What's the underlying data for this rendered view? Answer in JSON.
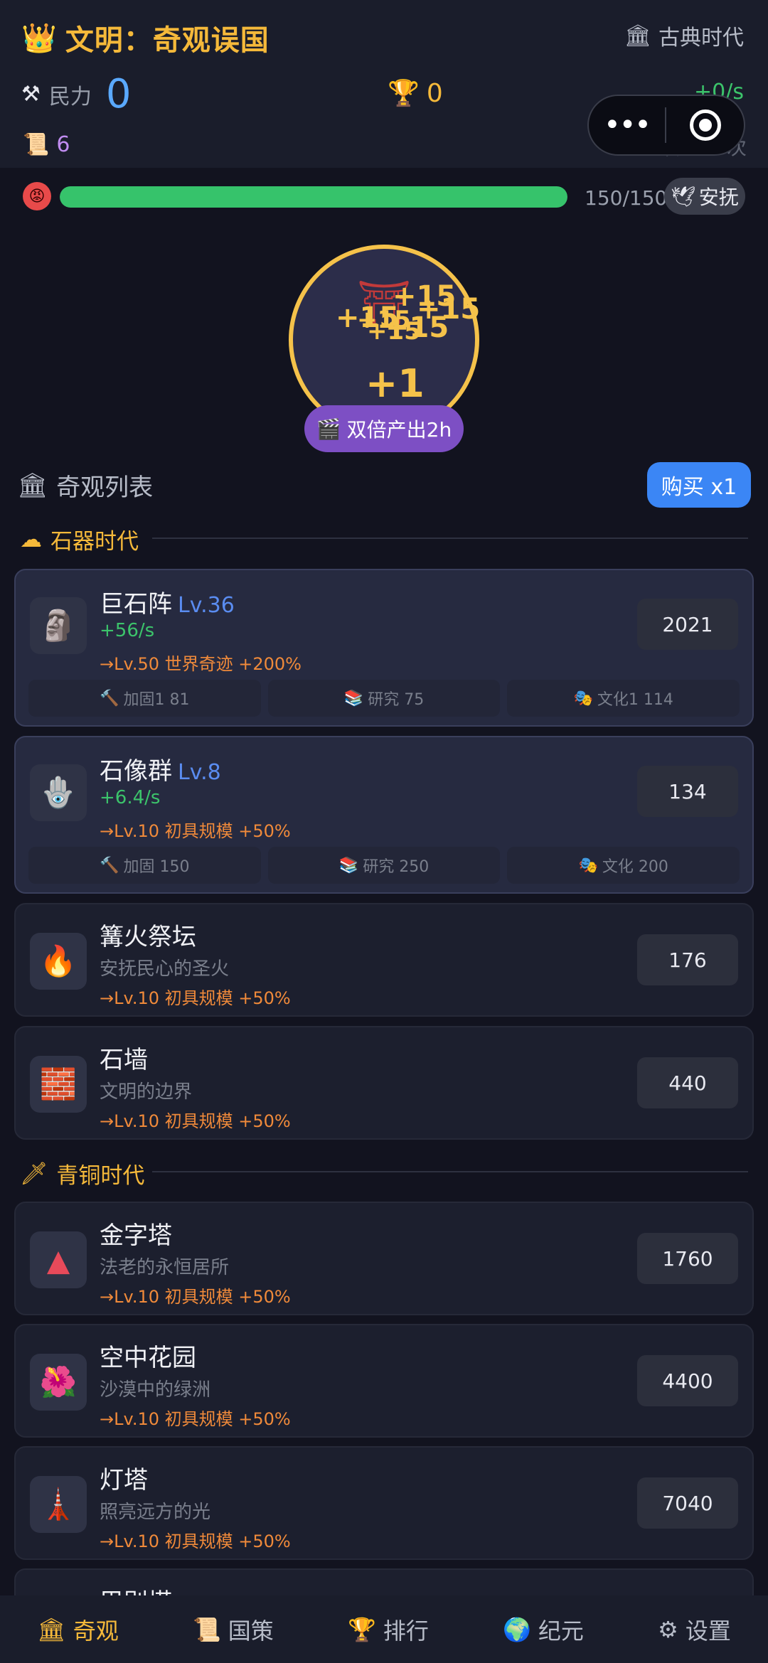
{
  "header": {
    "crown_icon": "crown",
    "title": "文明：奇观误国",
    "era_icon": "classical-building",
    "era": "古典时代",
    "power_label": "民力",
    "power_value": "0",
    "trophy_value": "0",
    "rate": "+0/s",
    "scroll_value": "6",
    "rebirth": "转世 3 次"
  },
  "capsule": {
    "more": "•••"
  },
  "unrest": {
    "face_icon": "angry-face",
    "progress_fraction": 1.0,
    "value": "150/150",
    "soothe_label": "安抚",
    "soothe_icon": "dove"
  },
  "wonder": {
    "icon": "temple",
    "floats": [
      "+15",
      "+15",
      "+15",
      "+15",
      "+15",
      "+15"
    ],
    "tap_gain": "+1",
    "double_label": "双倍产出2h",
    "double_icon": "clapper"
  },
  "list": {
    "icon": "classical-building",
    "title": "奇观列表",
    "buy_label": "购买 x1"
  },
  "ages": [
    {
      "icon": "cloud",
      "name": "石器时代",
      "cards": [
        {
          "icon": "moai",
          "name": "巨石阵",
          "level": "Lv.36",
          "sub": "+56/s",
          "goal": "→Lv.50 世界奇迹 +200%",
          "price": "2021",
          "owned": true,
          "upgrades": [
            {
              "icon": "hammer",
              "label": "加固1 81"
            },
            {
              "icon": "books",
              "label": "研究 75"
            },
            {
              "icon": "masks",
              "label": "文化1 114"
            }
          ]
        },
        {
          "icon": "hamsa",
          "name": "石像群",
          "level": "Lv.8",
          "sub": "+6.4/s",
          "goal": "→Lv.10 初具规模 +50%",
          "price": "134",
          "owned": true,
          "upgrades": [
            {
              "icon": "hammer",
              "label": "加固 150"
            },
            {
              "icon": "books",
              "label": "研究 250"
            },
            {
              "icon": "masks",
              "label": "文化 200"
            }
          ]
        },
        {
          "icon": "fire",
          "name": "篝火祭坛",
          "level": "",
          "sub": "安抚民心的圣火",
          "goal": "→Lv.10 初具规模 +50%",
          "price": "176",
          "owned": false
        },
        {
          "icon": "brick",
          "name": "石墙",
          "level": "",
          "sub": "文明的边界",
          "goal": "→Lv.10 初具规模 +50%",
          "price": "440",
          "owned": false
        }
      ]
    },
    {
      "icon": "dagger",
      "name": "青铜时代",
      "cards": [
        {
          "icon": "pyramid",
          "name": "金字塔",
          "level": "",
          "sub": "法老的永恒居所",
          "goal": "→Lv.10 初具规模 +50%",
          "price": "1760",
          "owned": false
        },
        {
          "icon": "hibiscus",
          "name": "空中花园",
          "level": "",
          "sub": "沙漠中的绿洲",
          "goal": "→Lv.10 初具规模 +50%",
          "price": "4400",
          "owned": false
        },
        {
          "icon": "tower",
          "name": "灯塔",
          "level": "",
          "sub": "照亮远方的光",
          "goal": "→Lv.10 初具规模 +50%",
          "price": "7040",
          "owned": false
        },
        {
          "icon": "",
          "name": "巴别塔",
          "level": "",
          "sub": "",
          "goal": "",
          "price": "",
          "owned": false
        }
      ]
    }
  ],
  "nav": [
    {
      "icon": "classical-building",
      "label": "奇观",
      "active": true
    },
    {
      "icon": "scroll",
      "label": "国策",
      "active": false
    },
    {
      "icon": "trophy",
      "label": "排行",
      "active": false
    },
    {
      "icon": "globe",
      "label": "纪元",
      "active": false
    },
    {
      "icon": "gear",
      "label": "设置",
      "active": false
    }
  ]
}
